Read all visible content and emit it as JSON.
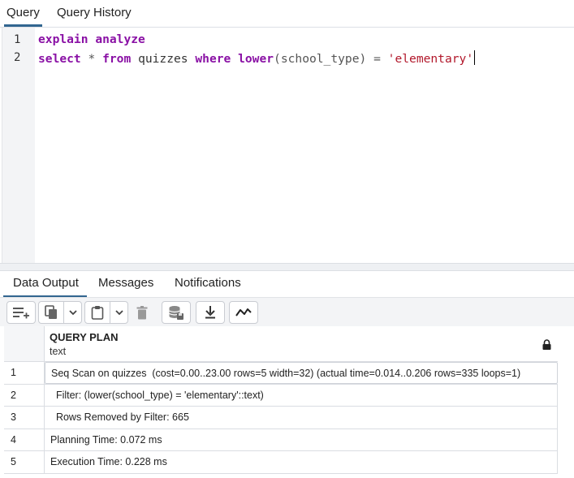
{
  "tabs": {
    "query": "Query",
    "history": "Query History"
  },
  "editor": {
    "line_numbers": [
      "1",
      "2"
    ],
    "line1": {
      "kw1": "explain",
      "kw2": "analyze"
    },
    "line2": {
      "kw_select": "select",
      "star": "*",
      "kw_from": "from",
      "table": "quizzes",
      "kw_where": "where",
      "fn": "lower",
      "args": "(school_type)",
      "eq": "=",
      "literal": "'elementary'"
    }
  },
  "output_tabs": {
    "data": "Data Output",
    "messages": "Messages",
    "notifications": "Notifications"
  },
  "toolbar": {
    "icons": [
      "add-row-icon",
      "copy-icon",
      "chevron-down-icon",
      "paste-icon",
      "chevron-down-icon",
      "delete-icon",
      "save-data-icon",
      "download-icon",
      "graph-icon"
    ]
  },
  "grid": {
    "column_title": "QUERY PLAN",
    "column_type": "text",
    "rows": [
      {
        "num": "1",
        "value": "Seq Scan on quizzes  (cost=0.00..23.00 rows=5 width=32) (actual time=0.014..0.206 rows=335 loops=1)"
      },
      {
        "num": "2",
        "value": "  Filter: (lower(school_type) = 'elementary'::text)"
      },
      {
        "num": "3",
        "value": "  Rows Removed by Filter: 665"
      },
      {
        "num": "4",
        "value": "Planning Time: 0.072 ms"
      },
      {
        "num": "5",
        "value": "Execution Time: 0.228 ms"
      }
    ]
  },
  "colors": {
    "accent": "#326690",
    "keyword": "#8a11a5",
    "string": "#b2182b"
  }
}
